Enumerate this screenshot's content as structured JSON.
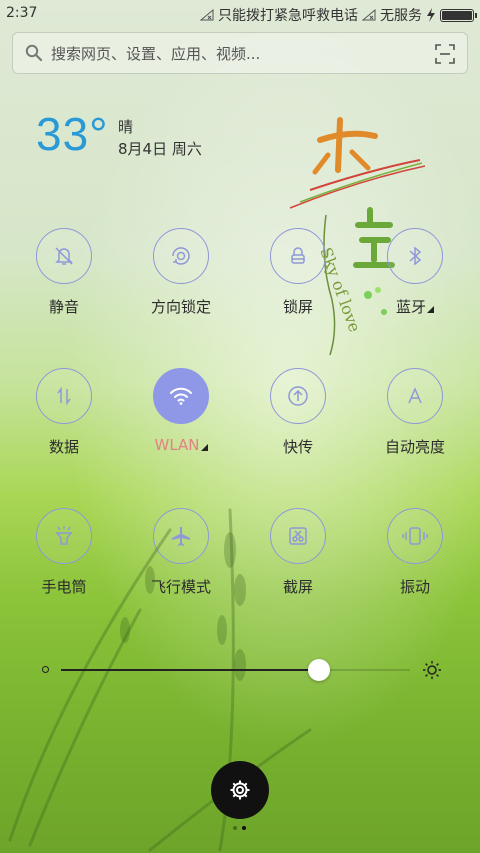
{
  "status_bar": {
    "time": "2:37",
    "notice": "只能拨打紧急呼救电话",
    "carrier": "无服务",
    "battery_level": 1.0
  },
  "search": {
    "placeholder": "搜索网页、设置、应用、视频..."
  },
  "weather": {
    "temperature": "33°",
    "condition": "晴",
    "date": "8月4日 周六"
  },
  "toggles": [
    {
      "label": "静音",
      "icon": "bell-off-icon",
      "active": false,
      "has_menu": false
    },
    {
      "label": "方向锁定",
      "icon": "rotation-lock-icon",
      "active": false,
      "has_menu": false
    },
    {
      "label": "锁屏",
      "icon": "lock-icon",
      "active": false,
      "has_menu": false
    },
    {
      "label": "蓝牙",
      "icon": "bluetooth-icon",
      "active": false,
      "has_menu": true
    },
    {
      "label": "数据",
      "icon": "mobile-data-icon",
      "active": false,
      "has_menu": false
    },
    {
      "label": "WLAN",
      "icon": "wifi-icon",
      "active": true,
      "has_menu": true
    },
    {
      "label": "快传",
      "icon": "quick-transfer-icon",
      "active": false,
      "has_menu": false
    },
    {
      "label": "自动亮度",
      "icon": "auto-brightness-icon",
      "active": false,
      "has_menu": false
    },
    {
      "label": "手电筒",
      "icon": "flashlight-icon",
      "active": false,
      "has_menu": false
    },
    {
      "label": "飞行模式",
      "icon": "airplane-icon",
      "active": false,
      "has_menu": false
    },
    {
      "label": "截屏",
      "icon": "screenshot-icon",
      "active": false,
      "has_menu": false
    },
    {
      "label": "振动",
      "icon": "vibrate-icon",
      "active": false,
      "has_menu": false
    }
  ],
  "brightness": {
    "level": 0.74
  },
  "pager": {
    "pages": 2,
    "current": 1
  },
  "colors": {
    "accent": "#8f98e6",
    "temperature": "#2a9ad6",
    "active_label": "#e77f86"
  }
}
